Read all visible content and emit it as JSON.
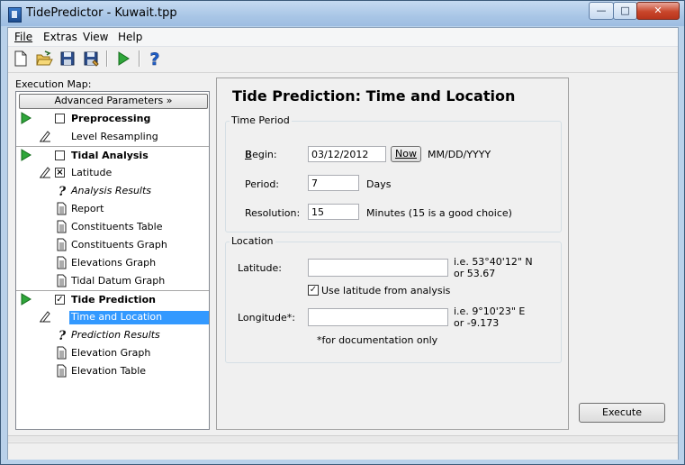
{
  "window": {
    "title": "TidePredictor - Kuwait.tpp",
    "min": "—",
    "max": "□",
    "close": "✕"
  },
  "menu": [
    "File",
    "Extras",
    "View",
    "Help"
  ],
  "toolbar_icons": [
    "new-file-icon",
    "open-folder-icon",
    "save-icon",
    "save-as-icon",
    "run-icon",
    "help-icon"
  ],
  "sidebar": {
    "label": "Execution Map:",
    "advanced_button": "Advanced Parameters »",
    "items": [
      {
        "label": "Preprocessing",
        "style": "bold",
        "icon": "play-icon",
        "checkbox": "unchecked"
      },
      {
        "label": "Level Resampling",
        "style": "normal",
        "icon": "pencil-icon"
      },
      {
        "label": "Tidal Analysis",
        "style": "bold",
        "icon": "play-icon",
        "checkbox": "unchecked"
      },
      {
        "label": "Latitude",
        "style": "normal",
        "icon": "pencil-icon",
        "checkbox": "crossed"
      },
      {
        "label": "Analysis Results",
        "style": "italic",
        "icon": "question-icon"
      },
      {
        "label": "Report",
        "style": "normal",
        "icon": "document-icon"
      },
      {
        "label": "Constituents Table",
        "style": "normal",
        "icon": "document-icon"
      },
      {
        "label": "Constituents Graph",
        "style": "normal",
        "icon": "document-icon"
      },
      {
        "label": "Elevations Graph",
        "style": "normal",
        "icon": "document-icon"
      },
      {
        "label": "Tidal Datum Graph",
        "style": "normal",
        "icon": "document-icon"
      },
      {
        "label": "Tide Prediction",
        "style": "bold",
        "icon": "play-icon",
        "checkbox": "checked"
      },
      {
        "label": "Time and Location",
        "style": "normal",
        "icon": "pencil-icon",
        "selected": true
      },
      {
        "label": "Prediction Results",
        "style": "italic",
        "icon": "question-icon"
      },
      {
        "label": "Elevation Graph",
        "style": "normal",
        "icon": "document-icon"
      },
      {
        "label": "Elevation Table",
        "style": "normal",
        "icon": "document-icon"
      }
    ]
  },
  "panel": {
    "title": "Tide Prediction: Time and Location",
    "time_period": {
      "legend": "Time Period",
      "begin_label": "Begin:",
      "begin_value": "03/12/2012",
      "now_button": "Now",
      "begin_hint": "MM/DD/YYYY",
      "period_label": "Period:",
      "period_value": "7",
      "period_unit": "Days",
      "resolution_label": "Resolution:",
      "resolution_value": "15",
      "resolution_hint": "Minutes (15 is a good choice)"
    },
    "location": {
      "legend": "Location",
      "latitude_label": "Latitude:",
      "latitude_value": "",
      "latitude_hint1": "i.e. 53°40'12\" N",
      "latitude_hint2": "or 53.67",
      "use_latitude_label": "Use latitude from analysis",
      "use_latitude_checked": true,
      "longitude_label": "Longitude*:",
      "longitude_value": "",
      "longitude_hint1": "i.e. 9°10'23\" E",
      "longitude_hint2": "or -9.173",
      "footnote": "*for documentation only"
    }
  },
  "execute_button": "Execute"
}
